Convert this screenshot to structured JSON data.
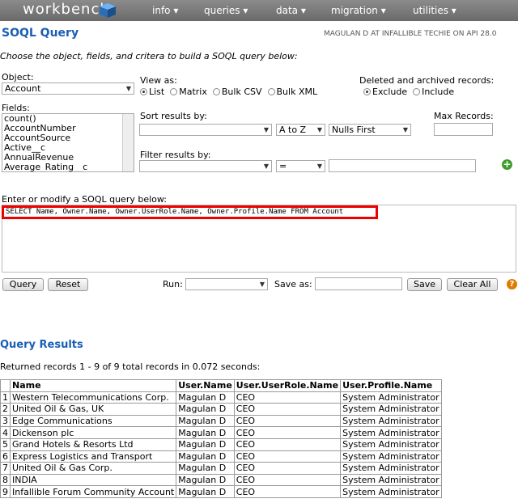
{
  "nav": {
    "logo": "workbench",
    "menus": [
      "info ▾",
      "queries ▾",
      "data ▾",
      "migration ▾",
      "utilities ▾"
    ]
  },
  "header": {
    "title": "SOQL Query",
    "user_info": "MAGULAN D AT INFALLIBLE TECHIE ON API 28.0"
  },
  "instructions": "Choose the object, fields, and critera to build a SOQL query below:",
  "object": {
    "label": "Object:",
    "value": "Account"
  },
  "view_as": {
    "label": "View as:",
    "options": [
      "List",
      "Matrix",
      "Bulk CSV",
      "Bulk XML"
    ],
    "selected": "List"
  },
  "deleted": {
    "label": "Deleted and archived records:",
    "options": [
      "Exclude",
      "Include"
    ],
    "selected": "Exclude"
  },
  "fields": {
    "label": "Fields:",
    "items": [
      "count()",
      "AccountNumber",
      "AccountSource",
      "Active__c",
      "AnnualRevenue",
      "Average_Rating__c"
    ]
  },
  "sort": {
    "label": "Sort results by:",
    "field": "",
    "direction": "A to Z",
    "nulls": "Nulls First"
  },
  "max_records": {
    "label": "Max Records:",
    "value": ""
  },
  "filter": {
    "label": "Filter results by:",
    "field": "",
    "operator": "=",
    "value": ""
  },
  "query": {
    "label": "Enter or modify a SOQL query below:",
    "text": "SELECT Name, Owner.Name, Owner.UserRole.Name, Owner.Profile.Name FROM Account"
  },
  "actions": {
    "query_label": "Query",
    "reset_label": "Reset",
    "run_label": "Run:",
    "save_as_label": "Save as:",
    "save_label": "Save",
    "clear_all_label": "Clear All"
  },
  "results": {
    "title": "Query Results",
    "summary": "Returned records 1 - 9 of 9 total records in 0.072 seconds:",
    "columns": [
      "",
      "Name",
      "User.Name",
      "User.UserRole.Name",
      "User.Profile.Name"
    ],
    "rows": [
      [
        "1",
        "Western Telecommunications Corp.",
        "Magulan D",
        "CEO",
        "System Administrator"
      ],
      [
        "2",
        "United Oil & Gas, UK",
        "Magulan D",
        "CEO",
        "System Administrator"
      ],
      [
        "3",
        "Edge Communications",
        "Magulan D",
        "CEO",
        "System Administrator"
      ],
      [
        "4",
        "Dickenson plc",
        "Magulan D",
        "CEO",
        "System Administrator"
      ],
      [
        "5",
        "Grand Hotels & Resorts Ltd",
        "Magulan D",
        "CEO",
        "System Administrator"
      ],
      [
        "6",
        "Express Logistics and Transport",
        "Magulan D",
        "CEO",
        "System Administrator"
      ],
      [
        "7",
        "United Oil & Gas Corp.",
        "Magulan D",
        "CEO",
        "System Administrator"
      ],
      [
        "8",
        "INDIA",
        "Magulan D",
        "CEO",
        "System Administrator"
      ],
      [
        "9",
        "Infallible Forum Community Account",
        "Magulan D",
        "CEO",
        "System Administrator"
      ]
    ]
  },
  "icons": {
    "add": "plus-icon",
    "help": "question-icon",
    "logo": "cube-icon"
  },
  "colors": {
    "accent": "#1a5fb4",
    "highlight_border": "#e00000",
    "nav_bg": "#7a7a7a"
  }
}
